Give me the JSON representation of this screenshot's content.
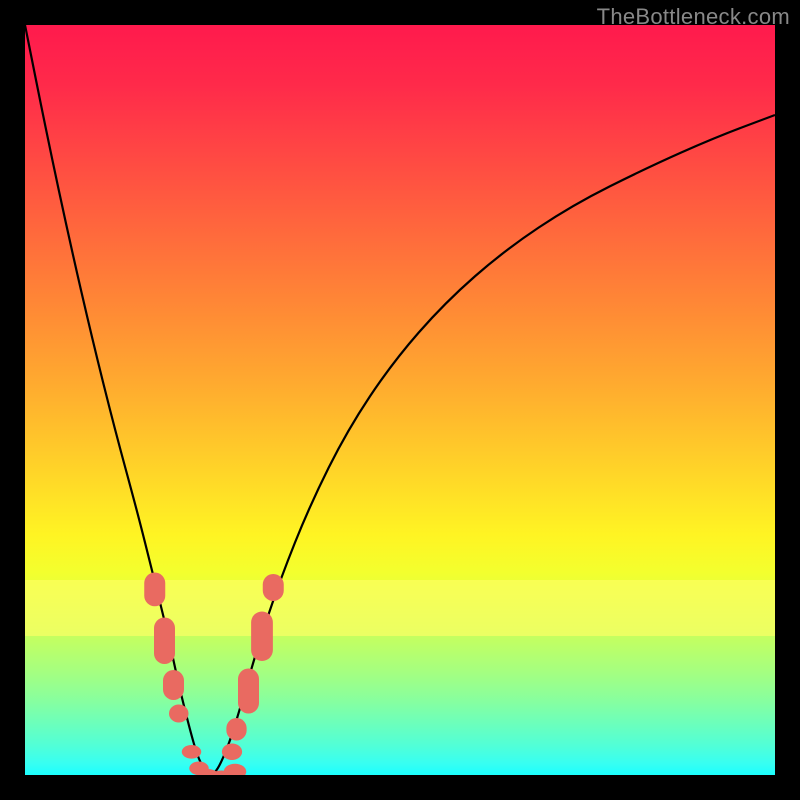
{
  "watermark": "TheBottleneck.com",
  "chart_data": {
    "type": "line",
    "title": "",
    "xlabel": "",
    "ylabel": "",
    "xlim": [
      0,
      100
    ],
    "ylim": [
      0,
      100
    ],
    "curve": {
      "description": "V-shaped bottleneck curve",
      "x": [
        0,
        3,
        6,
        9,
        12,
        15,
        17,
        19,
        20.5,
        22,
        23,
        24,
        24.8,
        25.5,
        26.3,
        27.5,
        29,
        31,
        34,
        38,
        43,
        49,
        56,
        64,
        73,
        83,
        92,
        100
      ],
      "y": [
        100,
        85,
        71,
        58,
        46,
        35,
        27,
        19,
        12,
        6,
        2.5,
        0.5,
        0,
        0.5,
        2,
        5,
        10,
        17,
        26,
        36,
        46,
        55,
        63,
        70,
        76,
        81,
        85,
        88
      ]
    },
    "markers": {
      "description": "salmon rounded segments near dip",
      "color": "#e96a61",
      "points": [
        {
          "x": 17.3,
          "y_top": 27.0,
          "y_bot": 22.5,
          "w": 2.8
        },
        {
          "x": 18.6,
          "y_top": 21.0,
          "y_bot": 14.8,
          "w": 2.8
        },
        {
          "x": 19.8,
          "y_top": 14.0,
          "y_bot": 10.0,
          "w": 2.8
        },
        {
          "x": 20.5,
          "y_top": 9.4,
          "y_bot": 7.0,
          "w": 2.6
        },
        {
          "x": 22.2,
          "y_top": 4.0,
          "y_bot": 2.3,
          "w": 2.6
        },
        {
          "x": 23.2,
          "y_top": 1.8,
          "y_bot": 0.6,
          "w": 2.6
        },
        {
          "x": 24.4,
          "y_top": 0.8,
          "y_bot": 0.1,
          "w": 3.0
        },
        {
          "x": 26.2,
          "y_top": 0.6,
          "y_bot": 0.1,
          "w": 3.4
        },
        {
          "x": 28.0,
          "y_top": 1.5,
          "y_bot": 0.4,
          "w": 3.0
        },
        {
          "x": 27.6,
          "y_top": 4.2,
          "y_bot": 2.0,
          "w": 2.7
        },
        {
          "x": 28.2,
          "y_top": 7.6,
          "y_bot": 4.6,
          "w": 2.7
        },
        {
          "x": 29.8,
          "y_top": 14.2,
          "y_bot": 8.2,
          "w": 2.8
        },
        {
          "x": 31.6,
          "y_top": 21.8,
          "y_bot": 15.2,
          "w": 2.9
        },
        {
          "x": 33.1,
          "y_top": 26.8,
          "y_bot": 23.2,
          "w": 2.8
        }
      ]
    },
    "gradient_stops": [
      {
        "pos": 0,
        "color": "#ff1a4d"
      },
      {
        "pos": 50,
        "color": "#ffab2f"
      },
      {
        "pos": 75,
        "color": "#fff423"
      },
      {
        "pos": 100,
        "color": "#1bffff"
      }
    ]
  }
}
